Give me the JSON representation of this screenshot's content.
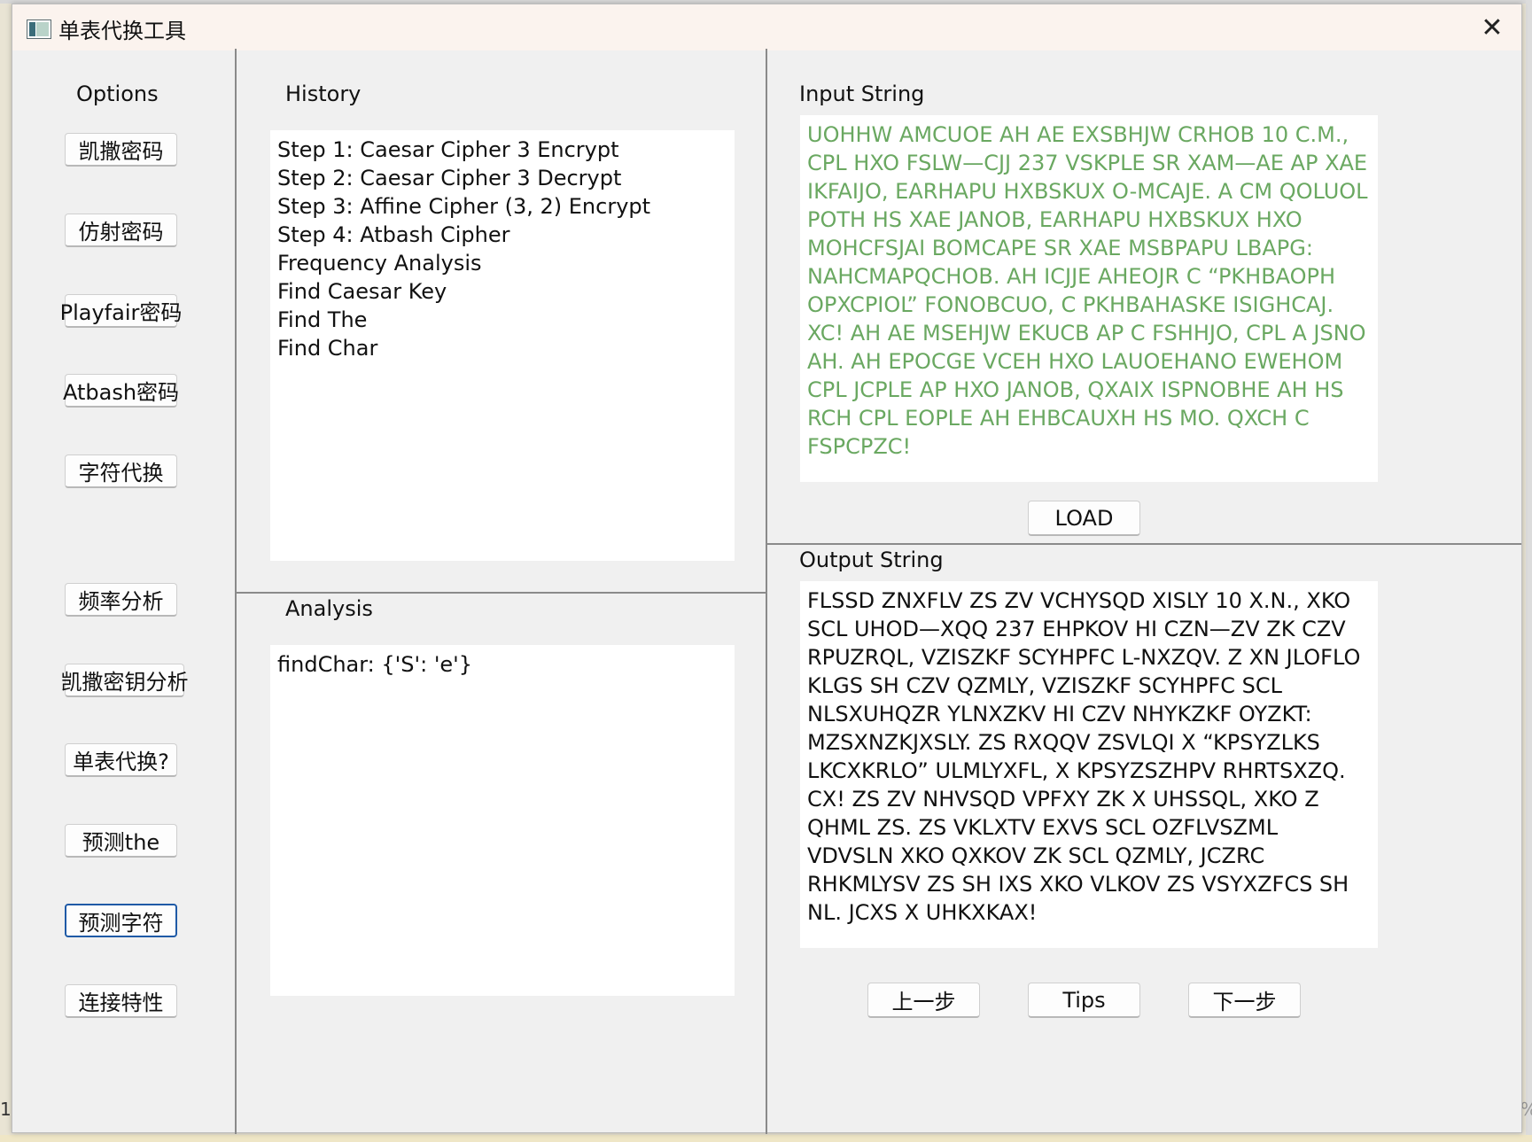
{
  "window": {
    "title": "单表代换工具",
    "close_glyph": "✕"
  },
  "options": {
    "title": "Options",
    "buttons": [
      "凯撒密码",
      "仿射密码",
      "Playfair密码",
      "Atbash密码",
      "字符代换",
      "频率分析",
      "凯撒密钥分析",
      "单表代换?",
      "预测the",
      "预测字符",
      "连接特性"
    ],
    "focused": "预测字符"
  },
  "history": {
    "title": "History",
    "items": [
      "Step 1: Caesar Cipher 3 Encrypt",
      "Step 2: Caesar Cipher 3 Decrypt",
      "Step 3: Affine Cipher (3, 2) Encrypt",
      "Step 4: Atbash Cipher",
      "Frequency Analysis",
      "Find Caesar Key",
      "Find The",
      "Find Char"
    ]
  },
  "analysis": {
    "title": "Analysis",
    "text": "findChar: {'S': 'e'}"
  },
  "input": {
    "title": "Input String",
    "text": "UOHHW AMCUOE AH AE EXSBHJW CRHOB 10 C.M., CPL HXO FSLW—CJJ 237 VSKPLE SR XAM—AE AP XAE IKFAIJO, EARHAPU HXBSKUX O-MCAJE. A CM QOLUOL POTH HS XAE JANOB, EARHAPU HXBSKUX HXO MOHCFSJAI BOMCAPE SR XAE MSBPAPU LBAPG: NAHCMAPQCHOB. AH ICJJE AHEOJR C “PKHBAOPH OPXCPIOL” FONOBCUO, C PKHBAHASKE ISIGHCAJ. XC! AH AE MSEHJW EKUCB AP C FSHHJO, CPL A JSNO AH. AH EPOCGE VCEH HXO LAUOEHANO EWEHOM CPL JCPLE AP HXO JANOB, QXAIX ISPNOBHE AH HS RCH CPL EOPLE AH EHBCAUXH HS MO. QXCH C FSPCPZC!",
    "text_color": "#6aa861",
    "load_label": "LOAD"
  },
  "output": {
    "title": "Output String",
    "text": "FLSSD ZNXFLV ZS ZV VCHYSQD XISLY 10 X.N., XKO SCL UHOD—XQQ 237 EHPKOV HI CZN—ZV ZK CZV RPUZRQL, VZISZKF SCYHPFC L-NXZQV. Z XN JLOFLO KLGS SH CZV QZMLY, VZISZKF SCYHPFC SCL NLSXUHQZR YLNXZKV HI CZV NHYKZKF OYZKT: MZSXNZKJXSLY. ZS RXQQV ZSVLQI X “KPSYZLKS LKCXKRLO” ULMLYXFL, X KPSYZSZHPV RHRTSXZQ. CX! ZS ZV NHVSQD VPFXY ZK X UHSSQL, XKO Z QHML ZS. ZS VKLXTV EXVS SCL OZFLVSZML VDVSLN XKO QXKOV ZK SCL QZMLY, JCZRC RHKMLYSV ZS SH IXS XKO VLKOV ZS VSYXZFCS SH NL. JCXS X UHKXKAX!"
  },
  "footer": {
    "prev_label": "上一步",
    "tips_label": "Tips",
    "next_label": "下一步"
  },
  "background": {
    "left_edge_text": "1",
    "right_edge_text": "%"
  }
}
